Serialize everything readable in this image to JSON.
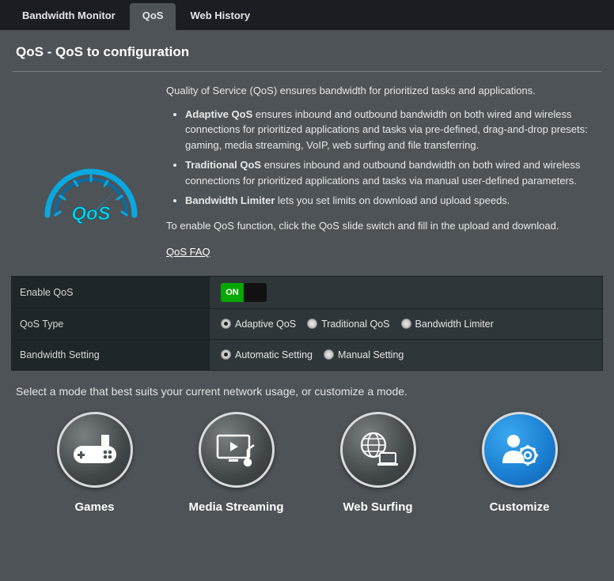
{
  "tabs": {
    "bandwidth": "Bandwidth Monitor",
    "qos": "QoS",
    "history": "Web History"
  },
  "page_title": "QoS - QoS to configuration",
  "intro": {
    "lead": "Quality of Service (QoS) ensures bandwidth for prioritized tasks and applications.",
    "adaptive_label": "Adaptive QoS",
    "adaptive_text": " ensures inbound and outbound bandwidth on both wired and wireless connections for prioritized applications and tasks via pre-defined, drag-and-drop presets: gaming, media streaming, VoIP, web surfing and file transferring.",
    "traditional_label": "Traditional QoS",
    "traditional_text": " ensures inbound and outbound bandwidth on both wired and wireless connections for prioritized applications and tasks via manual user-defined parameters.",
    "limiter_label": "Bandwidth Limiter",
    "limiter_text": " lets you set limits on download and upload speeds.",
    "enable_hint": "To enable QoS function, click the QoS slide switch and fill in the upload and download.",
    "faq": "QoS FAQ"
  },
  "settings": {
    "enable_label": "Enable QoS",
    "toggle_on": "ON",
    "type_label": "QoS Type",
    "type_adaptive": "Adaptive QoS",
    "type_traditional": "Traditional QoS",
    "type_limiter": "Bandwidth Limiter",
    "bw_label": "Bandwidth Setting",
    "bw_auto": "Automatic Setting",
    "bw_manual": "Manual Setting"
  },
  "mode_prompt": "Select a mode that best suits your current network usage, or customize a mode.",
  "modes": {
    "games": "Games",
    "media": "Media Streaming",
    "web": "Web Surfing",
    "customize": "Customize"
  }
}
